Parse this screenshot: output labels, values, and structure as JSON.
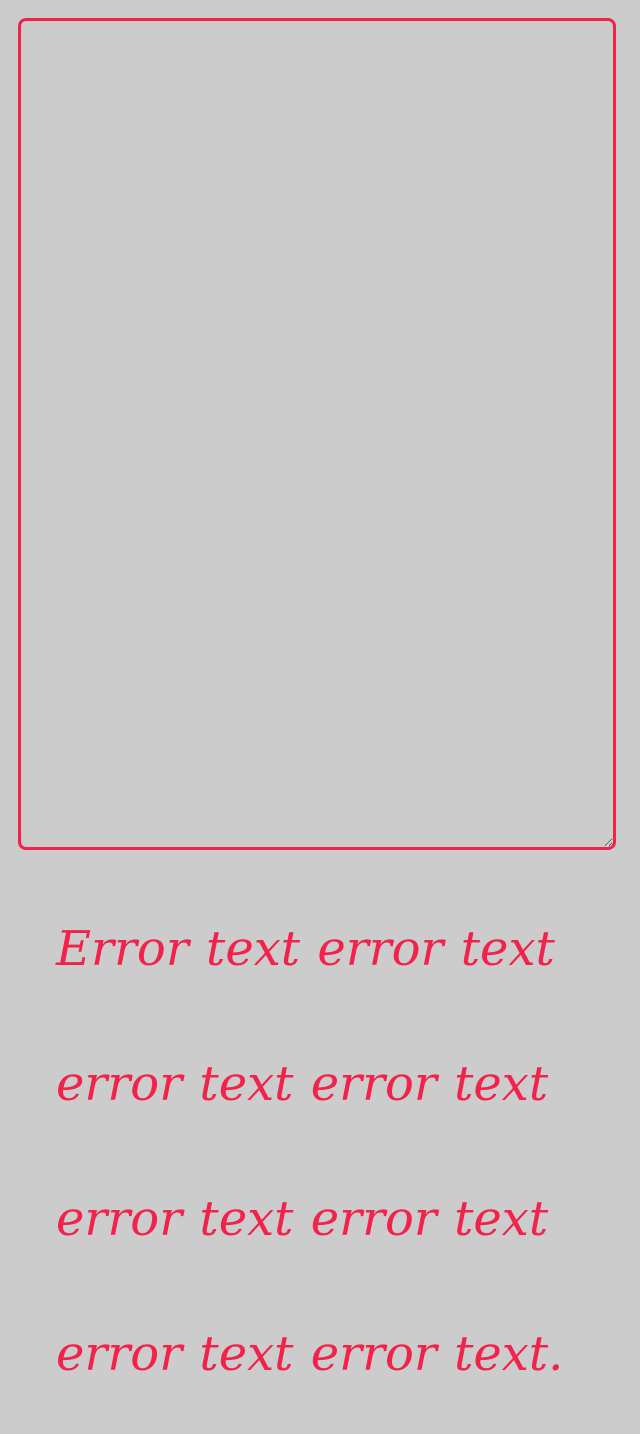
{
  "field": {
    "value": "",
    "state": "error"
  },
  "error": {
    "message": "Error text error text error text error text error text error text error text error text."
  },
  "colors": {
    "background": "#cccccc",
    "accent_error": "#f2224a"
  }
}
